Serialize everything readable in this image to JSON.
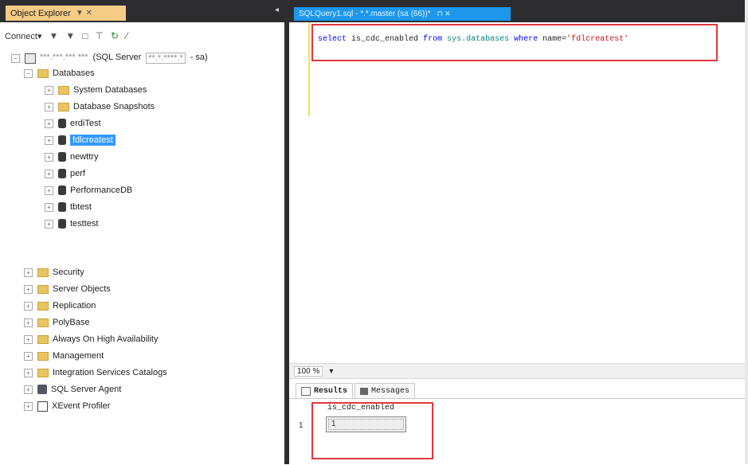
{
  "object_explorer": {
    "title": "Object Explorer",
    "title_controls": "▼ ✕",
    "pin": "◂",
    "toolbar": {
      "connect": "Connect▾",
      "icons": [
        "▼",
        "▼",
        "□",
        "⊤",
        "↻",
        "⁄"
      ]
    },
    "server": {
      "name": "***.***.*** ***",
      "suffix": "(SQL Server",
      "version": "**.*.****.*",
      "trail": "- sa)"
    },
    "tree": {
      "databases": "Databases",
      "system_databases": "System Databases",
      "database_snapshots": "Database Snapshots",
      "dbs": [
        "erdiTest",
        "fdlcreatest",
        "newttry",
        "perf",
        "PerformanceDB",
        "tbtest",
        "testtest"
      ],
      "selected_db": "fdlcreatest",
      "folders": [
        "Security",
        "Server Objects",
        "Replication",
        "PolyBase",
        "Always On High Availability",
        "Management",
        "Integration Services Catalogs"
      ],
      "agent": "SQL Server Agent",
      "xevent": "XEvent Profiler"
    }
  },
  "document": {
    "tab_label": "SQLQuery1.sql - *.*.master (sa (66))*",
    "tab_controls": "⊓ ✕"
  },
  "query": {
    "kw_select": "select",
    "col": "is_cdc_enabled",
    "kw_from": "from",
    "table": "sys.databases",
    "kw_where": "where",
    "cond_col": "name=",
    "value": "'fdlcreatest'"
  },
  "status": {
    "zoom": "100 %",
    "zoom_dropdown": "▾"
  },
  "results": {
    "tab_results": "Results",
    "tab_messages": "Messages",
    "column_header": "is_cdc_enabled",
    "row_number": "1",
    "cell_value": "1"
  },
  "colors": {
    "accent_tab": "#1c97ea",
    "oe_tab": "#f5cc84",
    "highlight_box": "#e0383e",
    "selection": "#3399ff"
  }
}
